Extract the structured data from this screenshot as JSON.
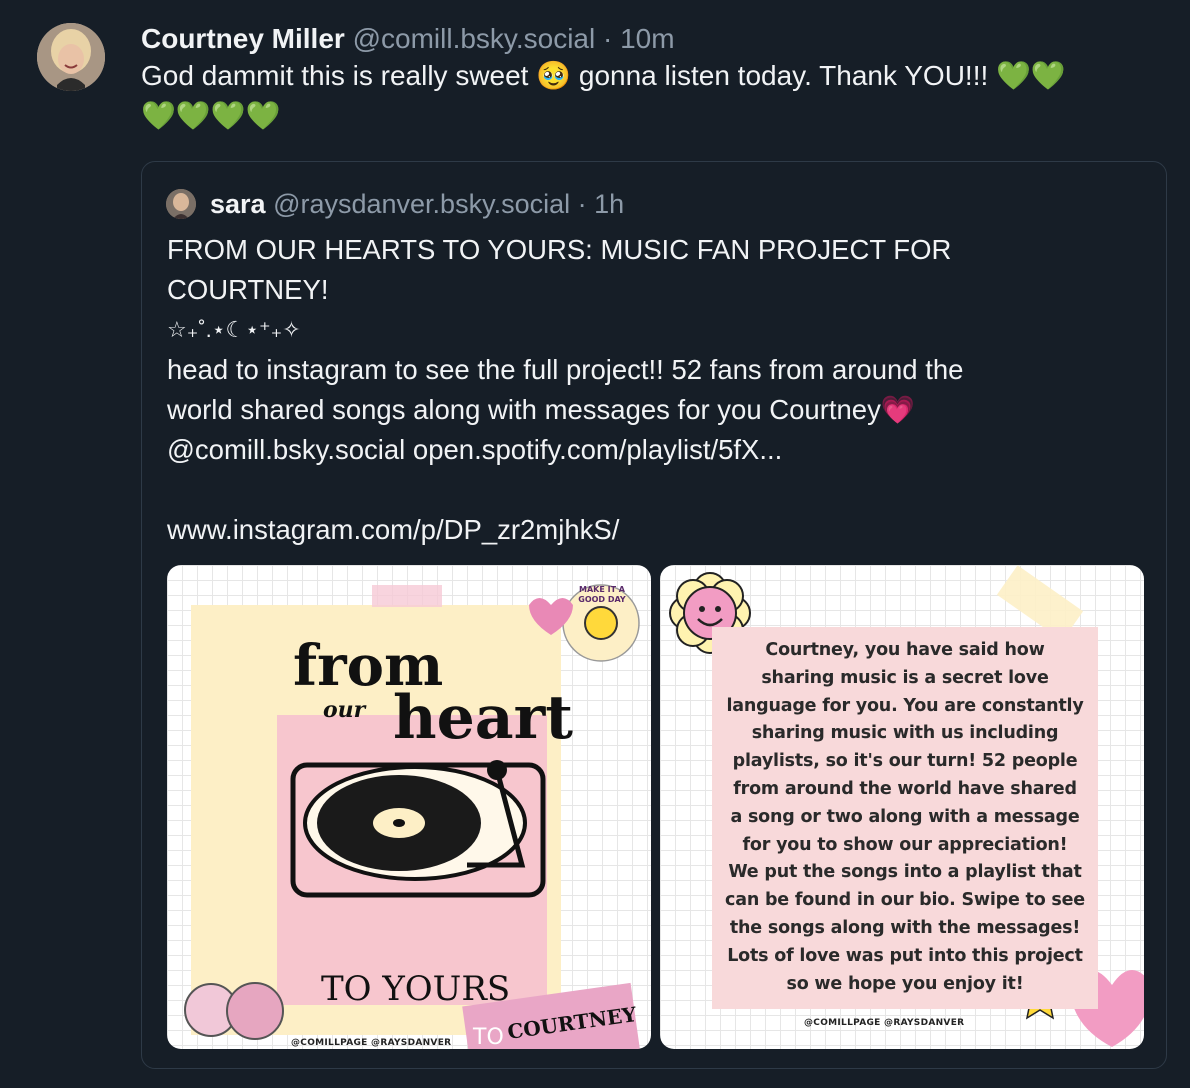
{
  "post": {
    "author_name": "Courtney Miller",
    "author_handle": "@comill.bsky.social",
    "separator": "·",
    "time": "10m",
    "text_line1": "God dammit this is really sweet 🥹 gonna listen today. Thank YOU!!! 💚💚",
    "text_line2": "💚💚💚💚"
  },
  "quote": {
    "author_name": "sara",
    "author_handle": "@raysdanver.bsky.social",
    "separator": "·",
    "time": "1h",
    "lines": [
      "FROM OUR HEARTS TO YOURS: MUSIC FAN PROJECT FOR",
      "COURTNEY!",
      "☆₊˚.⋆☾⋆⁺₊✧",
      "head to instagram to see the full project!! 52 fans from around the",
      "world shared songs along with messages for you Courtney💗",
      "@comill.bsky.social open.spotify.com/playlist/5fX...",
      "",
      "www.instagram.com/p/DP_zr2mjhkS/"
    ],
    "image1": {
      "title_from": "from",
      "title_our": "our",
      "title_heart": "heart",
      "title_to_yours": "TO YOURS",
      "sticker_text": "MAKE IT A GOOD DAY",
      "banner_to": "TO",
      "banner_name": "COURTNEY",
      "credit": "@COMILLPAGE @RAYSDANVER"
    },
    "image2": {
      "message_lines": [
        "Courtney, you have said how",
        "sharing music is a secret love",
        "language for you. You are constantly",
        "sharing music with us including",
        "playlists, so it's our turn! 52 people",
        "from around the world have shared",
        "a song or two along with a message",
        "for you to show our appreciation!",
        "We put the songs into a playlist that",
        "can be found in our bio. Swipe to see",
        "the songs along with the messages!",
        "Lots of love was put into this project",
        "so we hope you enjoy it!"
      ],
      "credit": "@COMILLPAGE @RAYSDANVER"
    }
  },
  "colors": {
    "background": "#161e27",
    "muted_text": "#8d9aa8",
    "border": "#2e3a47",
    "pink": "#e9a6c6",
    "cream": "#fdefc6"
  }
}
